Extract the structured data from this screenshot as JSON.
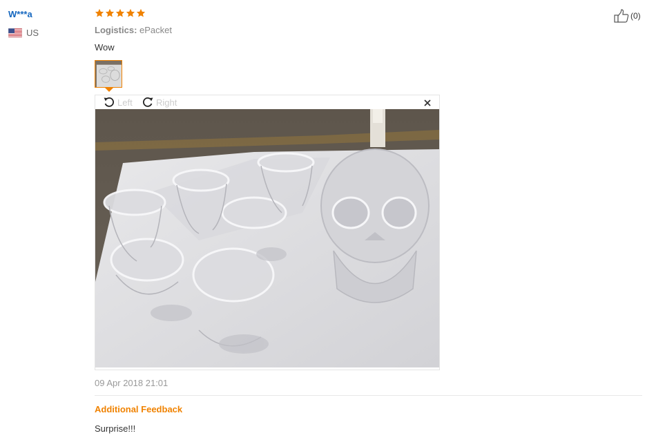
{
  "buyer": {
    "name": "W***a",
    "country": "US",
    "flag_icon": "us-flag-icon"
  },
  "review": {
    "rating": 5,
    "rating_max": 5,
    "star_color": "#f08200",
    "logistics_label": "Logistics:",
    "logistics_value": "ePacket",
    "text": "Wow",
    "date": "09 Apr 2018 21:01"
  },
  "viewer": {
    "rotate_left_label": "Left",
    "rotate_right_label": "Right",
    "rotate_left_icon": "rotate-left-icon",
    "rotate_right_icon": "rotate-right-icon",
    "close_icon": "close-icon",
    "photo_subject": "crystal skull decanter with glasses"
  },
  "additional_feedback": {
    "title": "Additional Feedback",
    "text": "Surprise!!!"
  },
  "helpful": {
    "icon": "thumbs-up-icon",
    "count": "(0)"
  },
  "colors": {
    "accent": "#f08200",
    "link": "#1567bf"
  }
}
